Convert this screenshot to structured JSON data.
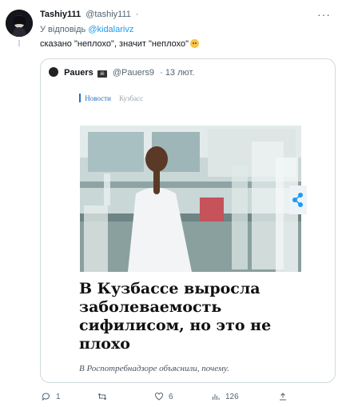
{
  "tweet": {
    "display_name": "Tashiy111",
    "handle": "@tashiy111",
    "separator": "·",
    "more_icon": "more-dots-icon",
    "reply_prefix": "У відповідь",
    "reply_mention": "@kidalarivz",
    "text": "сказано \"неплохо\", значит \"неплохо\"",
    "emoji": "slightly-frowning-face-emoji"
  },
  "quoted": {
    "display_name": "Pauers",
    "handle": "@Pauers9",
    "date": "· 13 лют.",
    "card": {
      "nav_news": "Новости",
      "nav_region": "Кузбасс",
      "headline": "В Кузбассе выросла заболеваемость сифилисом, но это не плохо",
      "subheadline": "В Роспотребнадзоре объяснили, почему.",
      "share_icon": "share-icon"
    }
  },
  "actions": {
    "replies": "1",
    "retweets": "",
    "likes": "6",
    "views": "126"
  },
  "colors": {
    "accent": "#1d9bf0",
    "nav_blue": "#2f6fb5",
    "muted": "#536471",
    "border": "#cfd9de"
  }
}
